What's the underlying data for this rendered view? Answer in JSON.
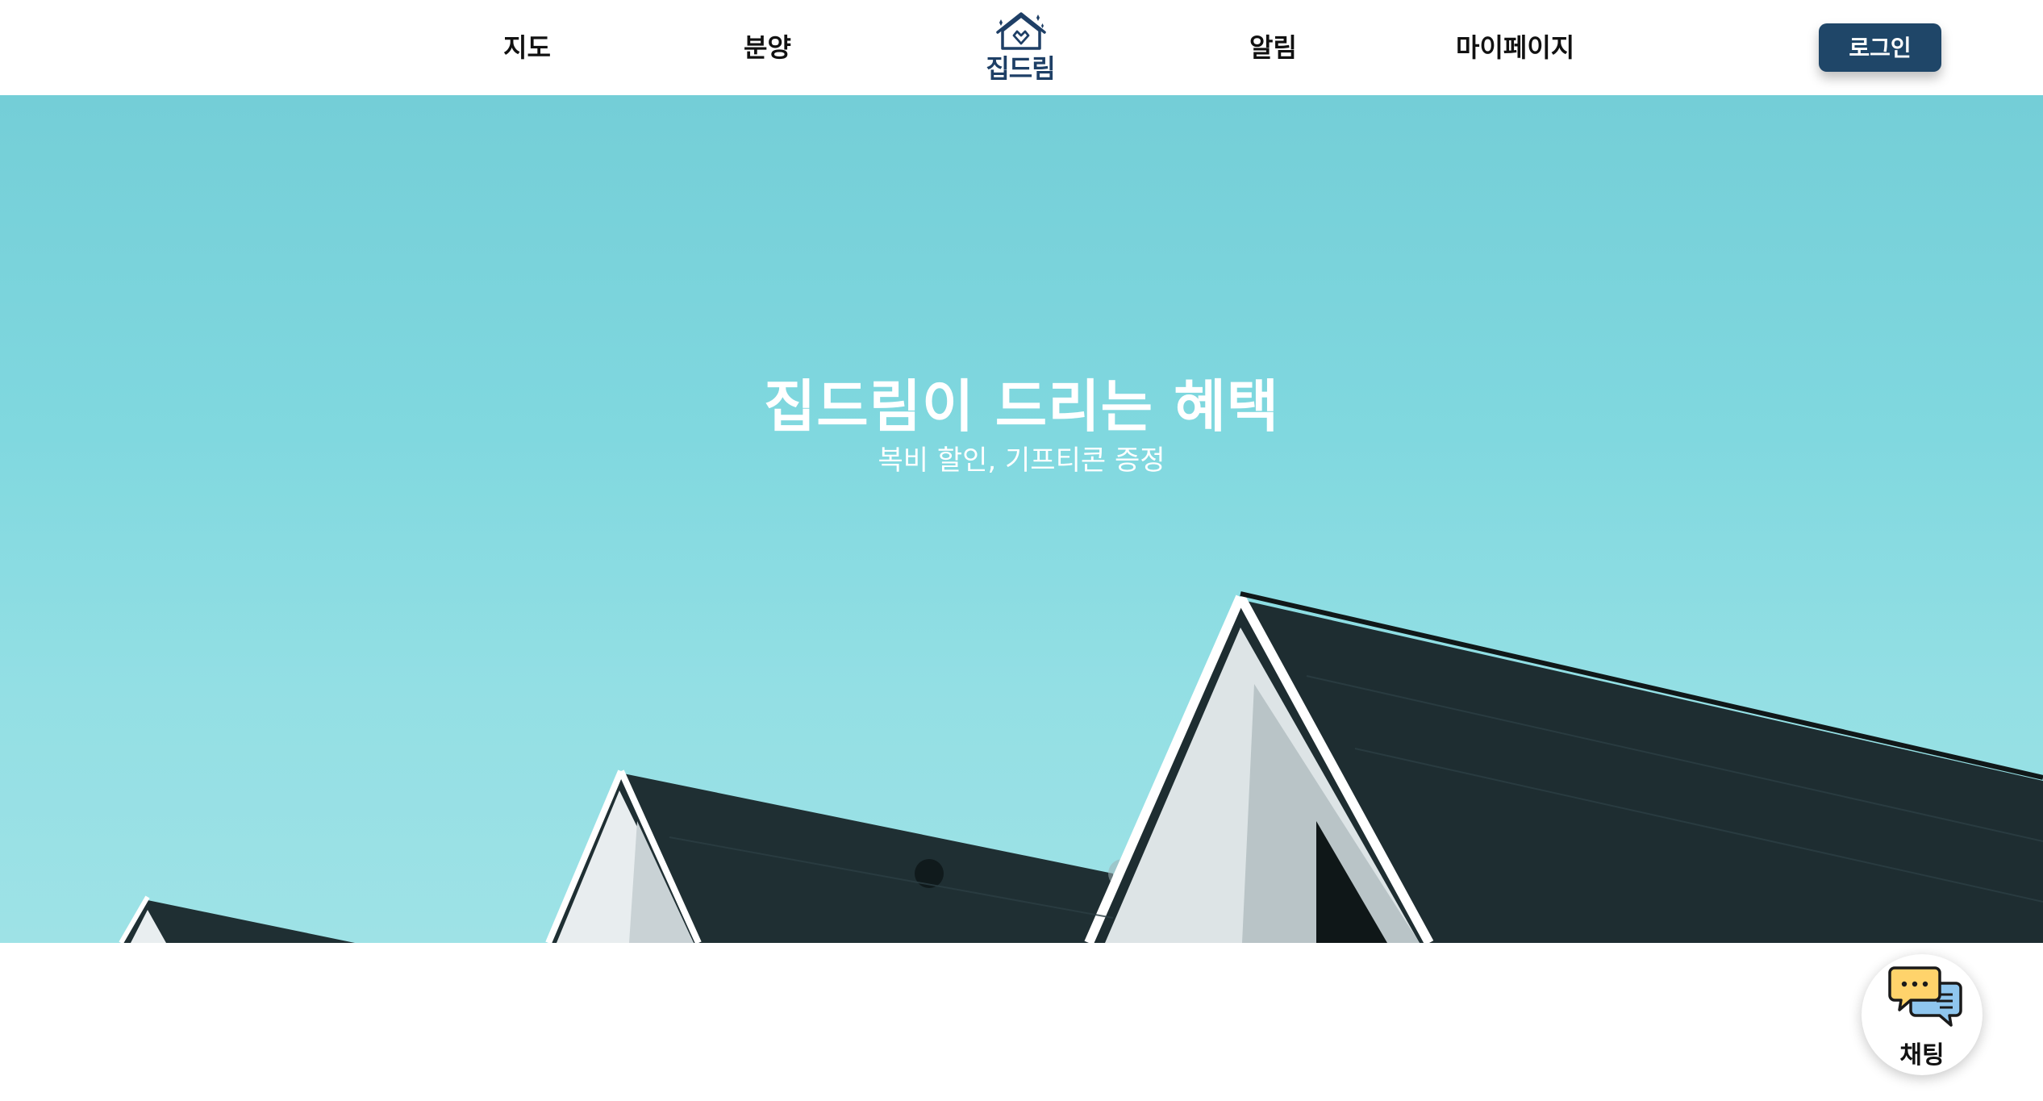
{
  "nav": {
    "items": [
      {
        "label": "지도"
      },
      {
        "label": "분양"
      },
      {
        "label": "알림"
      },
      {
        "label": "마이페이지"
      }
    ],
    "logo_text": "집드림",
    "login_label": "로그인"
  },
  "hero": {
    "title": "집드림이 드리는 혜택",
    "subtitle": "복비 할인, 기프티콘 증정"
  },
  "chat": {
    "label": "채팅"
  },
  "colors": {
    "brand_navy": "#1f4668",
    "sky": "#80d8df",
    "roof_dark": "#1f2f33"
  }
}
